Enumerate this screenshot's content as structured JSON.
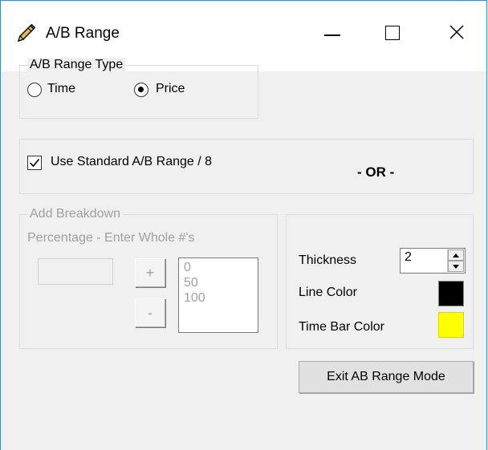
{
  "window": {
    "title": "A/B Range",
    "icon": "pencil-icon",
    "controls": [
      "minimize-icon",
      "maximize-icon",
      "close-icon"
    ]
  },
  "range_type": {
    "legend": "A/B Range Type",
    "options": [
      {
        "label": "Time",
        "selected": false
      },
      {
        "label": "Price",
        "selected": true
      }
    ]
  },
  "standard": {
    "checkbox_label": "Use Standard A/B Range / 8",
    "checked": true,
    "or_label": "- OR -"
  },
  "breakdown": {
    "legend": "Add Breakdown",
    "instruction": "Percentage - Enter Whole #'s",
    "input_value": "",
    "add_label": "+",
    "remove_label": "-",
    "items": [
      "0",
      "50",
      "100"
    ]
  },
  "style": {
    "thickness_label": "Thickness",
    "thickness_value": "2",
    "line_color_label": "Line Color",
    "line_color": "#000000",
    "time_bar_color_label": "Time Bar Color",
    "time_bar_color": "#ffff00"
  },
  "exit_button_label": "Exit AB Range Mode"
}
